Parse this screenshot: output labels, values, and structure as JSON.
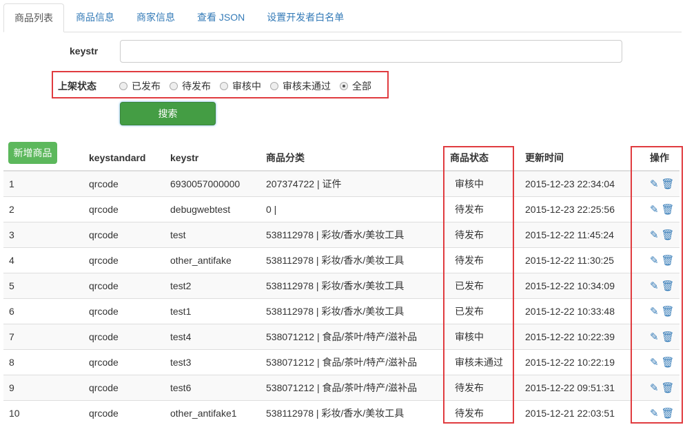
{
  "tabs": [
    "商品列表",
    "商品信息",
    "商家信息",
    "查看 JSON",
    "设置开发者白名单"
  ],
  "keystr_label": "keystr",
  "keystr_value": "",
  "status_label": "上架状态",
  "status_options": [
    "已发布",
    "待发布",
    "审核中",
    "审核未通过",
    "全部"
  ],
  "selected_status": "全部",
  "search_label": "搜索",
  "add_label": "新增商品",
  "columns": [
    "",
    "keystandard",
    "keystr",
    "商品分类",
    "商品状态",
    "更新时间",
    "操作"
  ],
  "rows": [
    [
      "1",
      "qrcode",
      "6930057000000",
      "207374722 | 证件",
      "审核中",
      "2015-12-23 22:34:04"
    ],
    [
      "2",
      "qrcode",
      "debugwebtest",
      "0 |",
      "待发布",
      "2015-12-23 22:25:56"
    ],
    [
      "3",
      "qrcode",
      "test",
      "538112978 | 彩妆/香水/美妆工具",
      "待发布",
      "2015-12-22 11:45:24"
    ],
    [
      "4",
      "qrcode",
      "other_antifake",
      "538112978 | 彩妆/香水/美妆工具",
      "待发布",
      "2015-12-22 11:30:25"
    ],
    [
      "5",
      "qrcode",
      "test2",
      "538112978 | 彩妆/香水/美妆工具",
      "已发布",
      "2015-12-22 10:34:09"
    ],
    [
      "6",
      "qrcode",
      "test1",
      "538112978 | 彩妆/香水/美妆工具",
      "已发布",
      "2015-12-22 10:33:48"
    ],
    [
      "7",
      "qrcode",
      "test4",
      "538071212 | 食品/茶叶/特产/滋补品",
      "审核中",
      "2015-12-22 10:22:39"
    ],
    [
      "8",
      "qrcode",
      "test3",
      "538071212 | 食品/茶叶/特产/滋补品",
      "审核未通过",
      "2015-12-22 10:22:19"
    ],
    [
      "9",
      "qrcode",
      "test6",
      "538071212 | 食品/茶叶/特产/滋补品",
      "待发布",
      "2015-12-22 09:51:31"
    ],
    [
      "10",
      "qrcode",
      "other_antifake1",
      "538112978 | 彩妆/香水/美妆工具",
      "待发布",
      "2015-12-21 22:03:51"
    ]
  ]
}
